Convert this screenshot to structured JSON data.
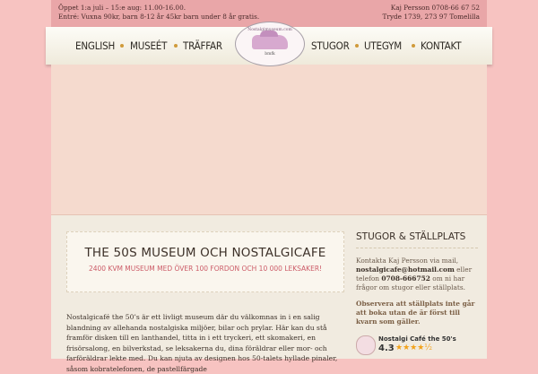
{
  "topbar": {
    "hours": "Öppet 1:a juli – 15:e aug: 11.00-16.00.",
    "prices": "Entré: Vuxna 90kr, barn 8-12 år 45kr barn under 8 år gratis.",
    "contact_name": "Kaj Persson 0708-66 67 52",
    "address": "Tryde 1739, 273 97 Tomelilla"
  },
  "nav": {
    "english": "ENGLISH",
    "museet": "MUSEÉT",
    "traffar": "TRÄFFAR",
    "stugor": "STUGOR",
    "utegym": "UTEGYM",
    "kontakt": "KONTAKT"
  },
  "logo": {
    "top_text": "Nostalgimuseum.com",
    "bottom_text": "bmfk"
  },
  "main": {
    "title": "THE 50S MUSEUM OCH NOSTALGICAFE",
    "subtitle": "2400 KVM MUSEUM MED ÖVER 100 FORDON OCH 10 000 LEKSAKER!",
    "body": "Nostalgicafé the 50’s är ett livligt museum där du välkomnas in i en salig blandning av allehanda nostalgiska miljöer, bilar och prylar. Här kan du stå framför disken till en lanthandel, titta in i ett tryckeri, ett skomakeri, en frisörsalong, en bilverkstad, se leksakerna du, dina föräldrar eller mor- och farföräldrar lekte med. Du kan njuta av designen hos 50-talets hyllade pinaler, såsom kobratelefonen, de pastellfärgade"
  },
  "sidebar": {
    "title": "STUGOR & STÄLLPLATS",
    "text_intro": "Kontakta Kaj Persson via mail, ",
    "email": "nostalgicafe@hotmail.com",
    "text_mid": " eller telefon ",
    "phone": "0708-666752",
    "text_end": " om ni har frågor om stugor eller ställplats.",
    "note": "Observera att ställplats inte går att boka utan de är först till kvarn som gäller.",
    "review": {
      "name": "Nostalgi Café the 50's",
      "score": "4.3",
      "stars": "★★★★½"
    }
  }
}
